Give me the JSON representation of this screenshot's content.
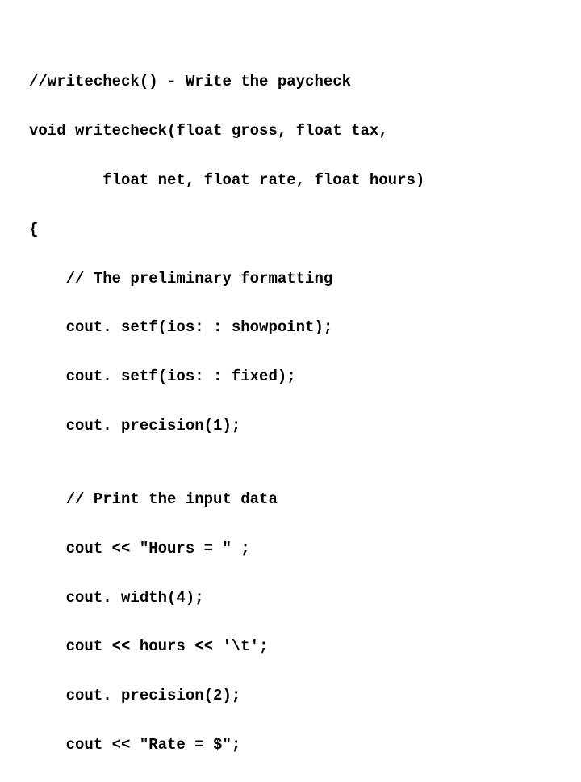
{
  "lines": {
    "l1": "//writecheck() - Write the paycheck",
    "l2": "void writecheck(float gross, float tax,",
    "l3": "        float net, float rate, float hours)",
    "l4": "{",
    "l5": "    // The preliminary formatting",
    "l6": "    cout. setf(ios: : showpoint);",
    "l7": "    cout. setf(ios: : fixed);",
    "l8": "    cout. precision(1);",
    "l9": "",
    "l10": "    // Print the input data",
    "l11": "    cout << \"Hours = \" ;",
    "l12": "    cout. width(4);",
    "l13": "    cout << hours << '\\t';",
    "l14": "    cout. precision(2);",
    "l15": "    cout << \"Rate = $\";"
  }
}
